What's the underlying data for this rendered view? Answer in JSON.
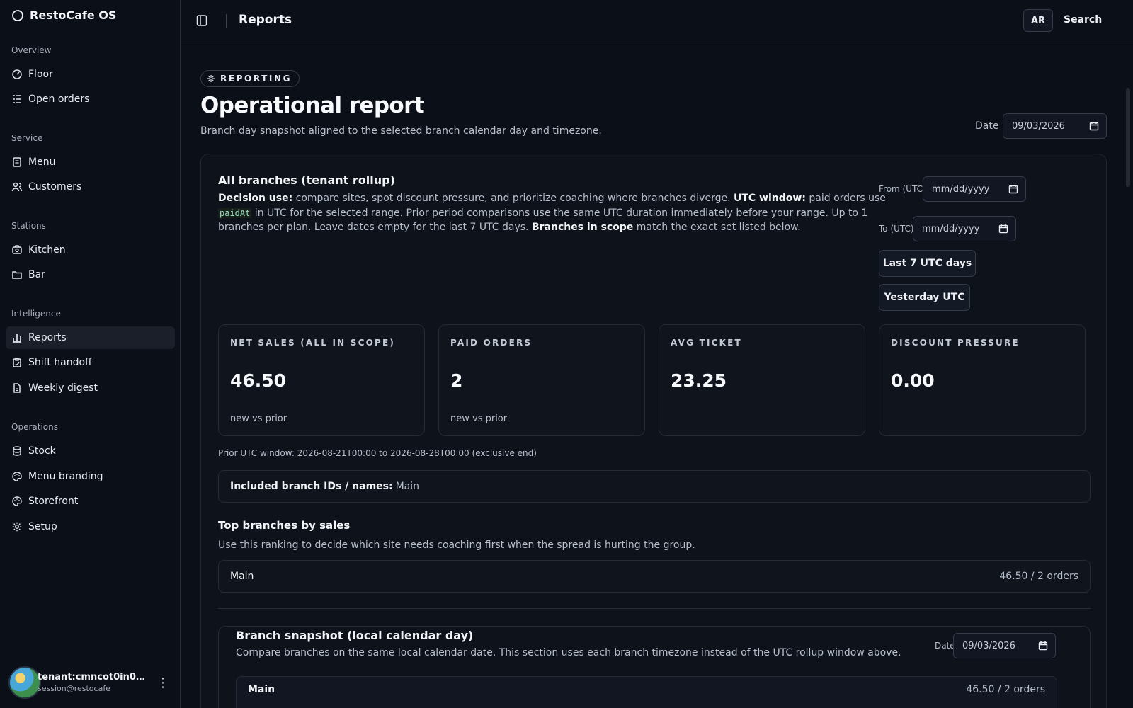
{
  "app": {
    "name": "RestoCafe OS"
  },
  "sidebar": {
    "sections": [
      {
        "title": "Overview"
      },
      {
        "title": "Service"
      },
      {
        "title": "Stations"
      },
      {
        "title": "Intelligence"
      },
      {
        "title": "Operations"
      }
    ],
    "items": [
      {
        "label": "Floor",
        "icon": "gauge-icon"
      },
      {
        "label": "Open orders",
        "icon": "list-icon"
      },
      {
        "label": "Menu",
        "icon": "document-icon"
      },
      {
        "label": "Customers",
        "icon": "users-icon"
      },
      {
        "label": "Kitchen",
        "icon": "camera-icon"
      },
      {
        "label": "Bar",
        "icon": "folder-icon"
      },
      {
        "label": "Reports",
        "icon": "bar-chart-icon",
        "active": true
      },
      {
        "label": "Shift handoff",
        "icon": "clipboard-icon"
      },
      {
        "label": "Weekly digest",
        "icon": "file-icon"
      },
      {
        "label": "Stock",
        "icon": "database-icon"
      },
      {
        "label": "Menu branding",
        "icon": "palette-icon"
      },
      {
        "label": "Storefront",
        "icon": "palette-icon"
      },
      {
        "label": "Setup",
        "icon": "gear-icon"
      }
    ],
    "user": {
      "name": "tenant:cmncot0in000...",
      "email": "session@restocafe"
    }
  },
  "topbar": {
    "title": "Reports",
    "language": "AR",
    "search_label": "Search"
  },
  "page": {
    "badge": "REPORTING",
    "title": "Operational report",
    "subtitle": "Branch day snapshot aligned to the selected branch calendar day and timezone.",
    "date_label": "Date",
    "date_value": "09/03/2026"
  },
  "rollup": {
    "title": "All branches (tenant rollup)",
    "desc": {
      "decision_label": "Decision use:",
      "decision_text": " compare sites, spot discount pressure, and prioritize coaching where branches diverge. ",
      "utc_label": "UTC window:",
      "utc_text_1": " paid orders use ",
      "utc_code": "paidAt",
      "utc_text_2": " in UTC for the selected range. Prior period comparisons use the same UTC duration immediately before your range. Up to 1 branches per plan. Leave dates empty for the last 7 UTC days. ",
      "scope_label": "Branches in scope",
      "scope_text": " match the exact set listed below."
    },
    "from_label": "From (UTC)",
    "to_label": "To (UTC)",
    "date_placeholder": "mm/dd/yyyy",
    "last_7_button": "Last 7 UTC days",
    "yesterday_button": "Yesterday UTC",
    "kpis": [
      {
        "label": "NET SALES (ALL IN SCOPE)",
        "value": "46.50",
        "sub": "new vs prior"
      },
      {
        "label": "PAID ORDERS",
        "value": "2",
        "sub": "new vs prior"
      },
      {
        "label": "AVG TICKET",
        "value": "23.25",
        "sub": ""
      },
      {
        "label": "DISCOUNT PRESSURE",
        "value": "0.00",
        "sub": ""
      }
    ],
    "prior_window": "Prior UTC window: 2026-08-21T00:00 to 2026-08-28T00:00 (exclusive end)",
    "included_label": "Included branch IDs / names:",
    "included_value": "Main"
  },
  "top_branches": {
    "title": "Top branches by sales",
    "desc": "Use this ranking to decide which site needs coaching first when the spread is hurting the group.",
    "rows": [
      {
        "name": "Main",
        "value": "46.50 / 2 orders"
      }
    ]
  },
  "snapshot": {
    "title": "Branch snapshot (local calendar day)",
    "desc": "Compare branches on the same local calendar date. This section uses each branch timezone instead of the UTC rollup window above.",
    "date_label": "Date",
    "date_value": "09/03/2026",
    "rows": [
      {
        "name": "Main",
        "value": "46.50 / 2 orders"
      }
    ]
  },
  "icons": {
    "brand": "circle-logo-icon",
    "sidebar_toggle": "sidebar-toggle-icon",
    "badge": "sparkle-icon",
    "calendar": "calendar-icon",
    "user_menu": "more-vertical-icon"
  }
}
